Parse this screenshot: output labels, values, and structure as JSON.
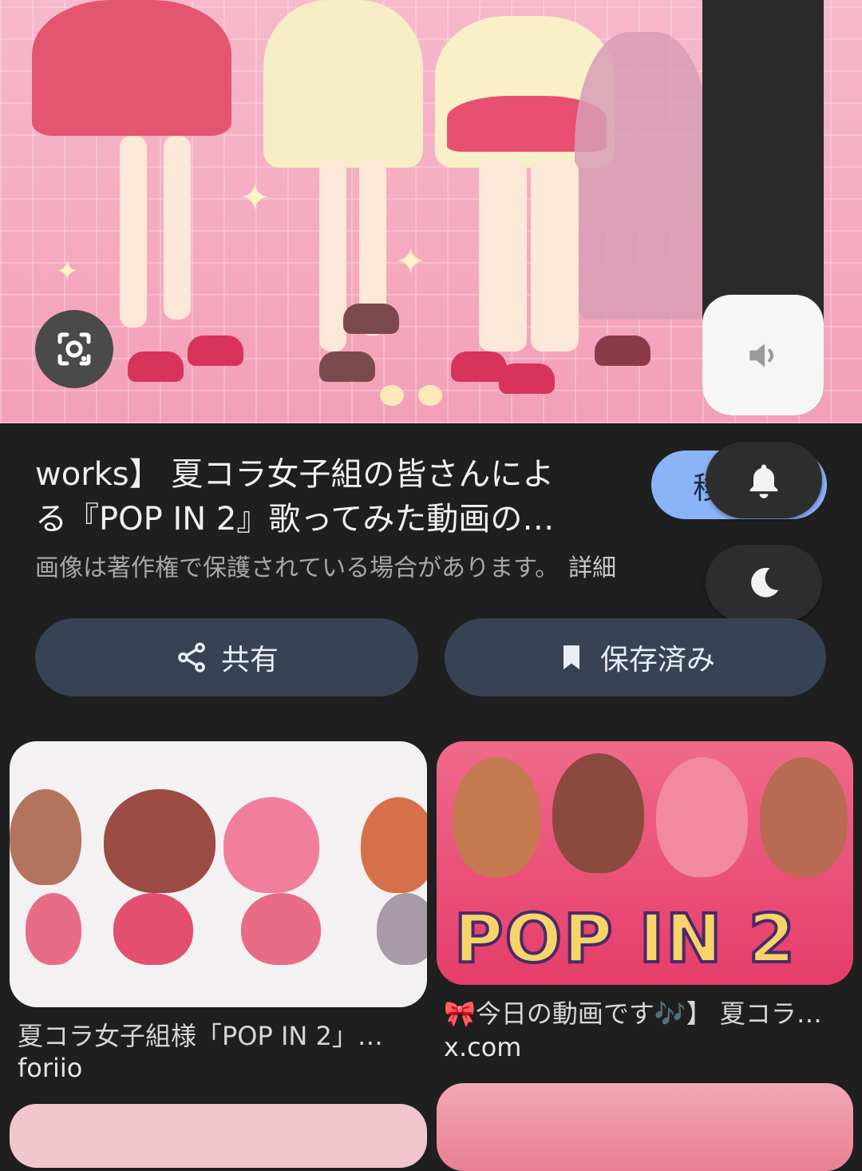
{
  "hero": {
    "lens_icon": "google-lens-icon"
  },
  "overlay": {
    "volume_icon": "speaker-icon",
    "volume_level": 0.29,
    "bell_icon": "bell-icon",
    "moon_icon": "moon-icon"
  },
  "result": {
    "title_line1": "works】 夏コラ女子組の皆さんによ",
    "title_line2": "る『POP IN 2』歌ってみた動画の…",
    "visit_label": "移",
    "copyright_text": "画像は著作権で保護されている場合があります。",
    "details_label": "詳細",
    "share_label": "共有",
    "share_icon": "share-icon",
    "saved_label": "保存済み",
    "saved_icon": "bookmark-icon"
  },
  "related": [
    {
      "title": "夏コラ女子組様「POP IN 2」…",
      "source": "foriio"
    },
    {
      "title": "🎀今日の動画です🎶】 夏コラ…",
      "source": "x.com",
      "image_text": "POP IN 2"
    }
  ],
  "colors": {
    "background": "#1f1f1f",
    "button": "#374254",
    "accent": "#8ab4f8",
    "hero_pink": "#f5a9bf"
  }
}
